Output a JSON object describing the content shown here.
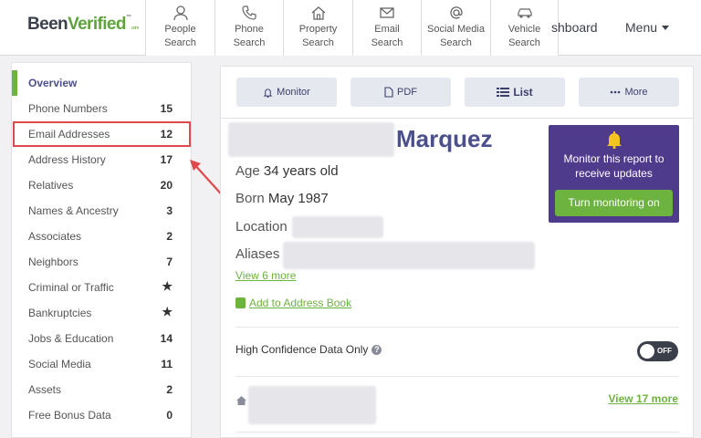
{
  "brand": {
    "part1": "Been",
    "part2": "Verified",
    "tm": "™",
    "com": ".com"
  },
  "nav": {
    "tabs": [
      {
        "label": "People\nSearch",
        "icon": "person-icon"
      },
      {
        "label": "Phone\nSearch",
        "icon": "phone-icon"
      },
      {
        "label": "Property\nSearch",
        "icon": "house-icon"
      },
      {
        "label": "Email\nSearch",
        "icon": "envelope-icon"
      },
      {
        "label": "Social Media\nSearch",
        "icon": "at-icon"
      },
      {
        "label": "Vehicle\nSearch",
        "icon": "car-icon"
      }
    ],
    "dashboard_partial": "shboard",
    "menu_label": "Menu"
  },
  "sidebar": {
    "items": [
      {
        "label": "Overview",
        "count": ""
      },
      {
        "label": "Phone Numbers",
        "count": "15"
      },
      {
        "label": "Email Addresses",
        "count": "12"
      },
      {
        "label": "Address History",
        "count": "17"
      },
      {
        "label": "Relatives",
        "count": "20"
      },
      {
        "label": "Names & Ancestry",
        "count": "3"
      },
      {
        "label": "Associates",
        "count": "2"
      },
      {
        "label": "Neighbors",
        "count": "7"
      },
      {
        "label": "Criminal or Traffic",
        "count": "★"
      },
      {
        "label": "Bankruptcies",
        "count": "★"
      },
      {
        "label": "Jobs & Education",
        "count": "14"
      },
      {
        "label": "Social Media",
        "count": "11"
      },
      {
        "label": "Assets",
        "count": "2"
      },
      {
        "label": "Free Bonus Data",
        "count": "0"
      }
    ]
  },
  "actions": {
    "monitor": "Monitor",
    "pdf": "PDF",
    "list": "List",
    "more": "More"
  },
  "report": {
    "last_name": "Marquez",
    "age_label": "Age",
    "age_value": "34 years old",
    "born_label": "Born",
    "born_value": "May 1987",
    "location_label": "Location",
    "aliases_label": "Aliases",
    "view_more": "View 6 more",
    "add_address_book": "Add to Address Book",
    "high_confidence": "High Confidence Data Only",
    "toggle_state": "OFF",
    "view_addresses": "View 17 more"
  },
  "promo": {
    "text": "Monitor this report to receive updates",
    "button": "Turn monitoring on"
  },
  "colors": {
    "accent_green": "#6db33f",
    "brand_purple": "#4f3b8c",
    "name_purple": "#4b4f8c",
    "highlight_red": "#e0494c"
  }
}
